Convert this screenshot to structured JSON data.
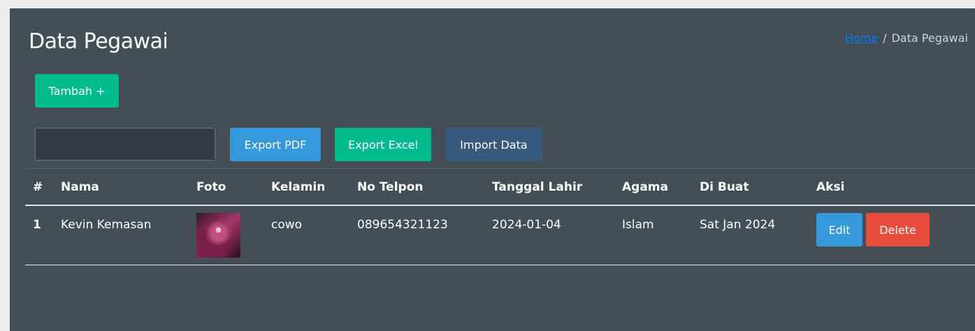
{
  "header": {
    "title": "Data Pegawai",
    "breadcrumb": {
      "home": "Home",
      "separator": "/",
      "current": "Data Pegawai"
    }
  },
  "toolbar": {
    "add_label": "Tambah +",
    "search_value": "",
    "export_pdf_label": "Export PDF",
    "export_excel_label": "Export Excel",
    "import_label": "Import Data"
  },
  "table": {
    "headers": [
      "#",
      "Nama",
      "Foto",
      "Kelamin",
      "No Telpon",
      "Tanggal Lahir",
      "Agama",
      "Di Buat",
      "Aksi"
    ],
    "rows": [
      {
        "no": "1",
        "nama": "Kevin Kemasan",
        "foto": "profile-photo",
        "kelamin": "cowo",
        "telpon": "089654321123",
        "tanggal_lahir": "2024-01-04",
        "agama": "Islam",
        "dibuat": "Sat Jan 2024",
        "edit_label": "Edit",
        "delete_label": "Delete"
      }
    ]
  },
  "colors": {
    "panel_bg": "#454d55",
    "primary": "#3498db",
    "success": "#00bc8c",
    "danger": "#e74c3c",
    "import": "#375a7f"
  }
}
